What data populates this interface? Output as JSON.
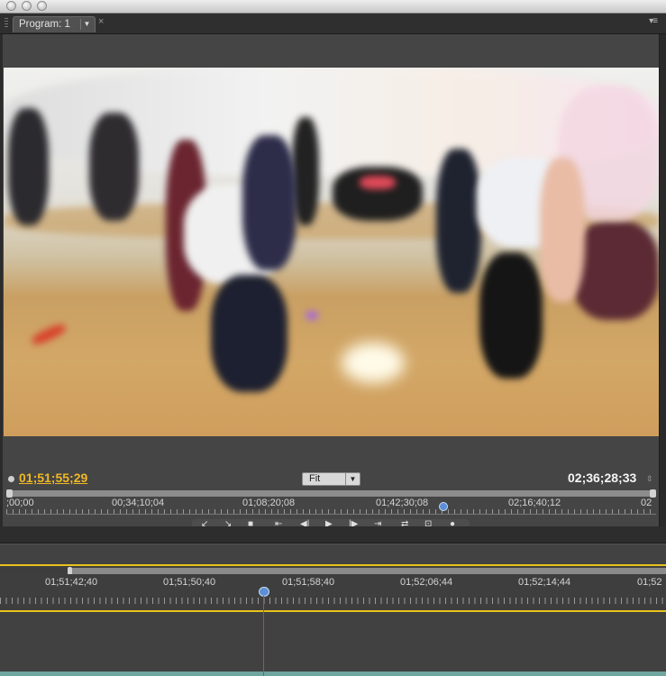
{
  "window": {
    "buttons": [
      "close",
      "minimize",
      "zoom"
    ]
  },
  "panel": {
    "tab_label": "Program: 1",
    "tab_menu_icon": "dropdown-arrow-icon",
    "close_glyph": "×",
    "panel_menu_glyph": "▾≡"
  },
  "video": {
    "description_icon": "video-frame"
  },
  "monitor": {
    "current_timecode": "01;51;55;29",
    "zoom_select": "Fit",
    "duration_timecode": "02;36;28;33",
    "ruler_labels": [
      ";00;00",
      "00;34;10;04",
      "01;08;20;08",
      "01;42;30;08",
      "02;16;40;12",
      "02"
    ],
    "transport_glyphs": [
      "↙",
      "↘",
      "■",
      "⇤",
      "◀|",
      "▶",
      "|▶",
      "⇥",
      "⇄",
      "⊡",
      "●"
    ]
  },
  "timeline": {
    "ruler_labels": [
      "01;51;42;40",
      "01;51;50;40",
      "01;51;58;40",
      "01;52;06;44",
      "01;52;14;44",
      "01;52"
    ]
  },
  "colors": {
    "timecode_current": "#f1b825",
    "playhead": "#5b8fd6",
    "playhead_line": "#e3372b",
    "work_area": "#e8c21a",
    "clip": "#6fa6a0"
  }
}
